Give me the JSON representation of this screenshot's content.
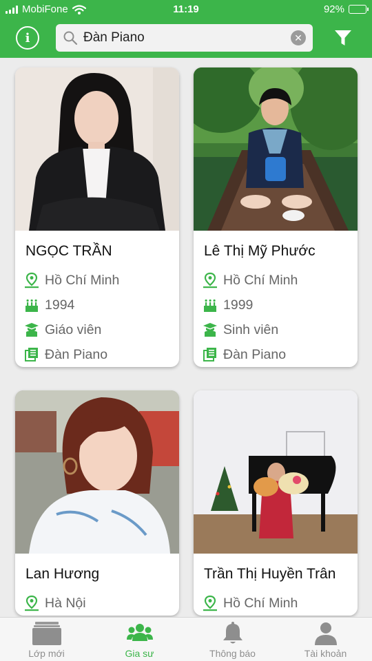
{
  "status_bar": {
    "carrier": "MobiFone",
    "time": "11:19",
    "battery": "92%",
    "battery_level": 0.92
  },
  "search": {
    "value": "Đàn Piano"
  },
  "tutors": [
    {
      "name": "NGỌC TRẦN",
      "location": "Hồ Chí Minh",
      "birth_year": "1994",
      "occupation": "Giáo viên",
      "subject": "Đàn Piano"
    },
    {
      "name": "Lê Thị Mỹ Phước",
      "location": "Hồ Chí Minh",
      "birth_year": "1999",
      "occupation": "Sinh viên",
      "subject": "Đàn Piano"
    },
    {
      "name": "Lan Hương",
      "location": "Hà Nội"
    },
    {
      "name": "Trần Thị Huyền Trân",
      "location": "Hồ Chí Minh"
    }
  ],
  "tabs": [
    {
      "label": "Lớp mới",
      "icon": "classes-icon",
      "active": false
    },
    {
      "label": "Gia sư",
      "icon": "tutors-icon",
      "active": true
    },
    {
      "label": "Thông báo",
      "icon": "bell-icon",
      "active": false
    },
    {
      "label": "Tài khoản",
      "icon": "account-icon",
      "active": false
    }
  ],
  "colors": {
    "brand": "#3cb54a",
    "inactive": "#8e8e8e"
  }
}
